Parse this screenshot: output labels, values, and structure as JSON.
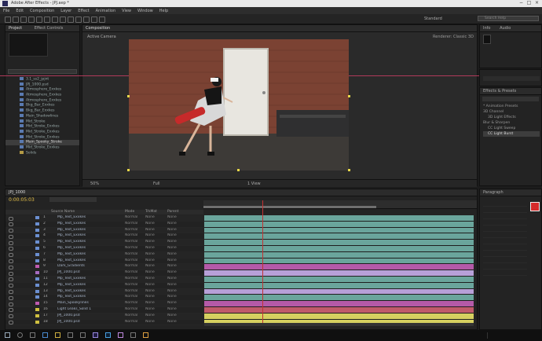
{
  "app": {
    "title": "Adobe After Effects - JPJ.aep *"
  },
  "menu": [
    "File",
    "Edit",
    "Composition",
    "Layer",
    "Effect",
    "Animation",
    "View",
    "Window",
    "Help"
  ],
  "toolbar": {
    "workspace_label": "Standard",
    "search_placeholder": "Search Help"
  },
  "project": {
    "tab": "Project",
    "tab2": "Effect Controls",
    "items": [
      "3.1_ss2_jpjnt",
      "JPJ_1000.psd",
      "Atmosphere_Exxkes",
      "Atmosphere_Exxkes",
      "Atmosphere_Exxkes",
      "Bkg_Bar_Exxkes",
      "Bkg_Bar_Exxkes",
      "Main_Shadowlines",
      "Mid_Stroke",
      "Mid_Stroke_Exxkes",
      "Mid_Stroke_Exxkes",
      "Mid_Stroke_Exxkes",
      "Main_Spooky_Stroke",
      "Mid_Stroke_Exxkes",
      "Solids"
    ],
    "selected_index": 12
  },
  "viewer": {
    "tab": "Composition",
    "camera_label": "Active Camera",
    "renderer_label": "Renderer: Classic 3D",
    "zoom": "50%",
    "res": "Full",
    "view": "1 View"
  },
  "timeline": {
    "tab": "JPJ_1000",
    "timecode": "0:00:05:03",
    "col_headers": {
      "name": "Source Name",
      "mode": "Mode",
      "trk": "TrkMat",
      "parent": "Parent"
    },
    "layers": [
      {
        "num": "1",
        "name": "Mp_Text_Exxkes",
        "color": "#6b8fd0"
      },
      {
        "num": "2",
        "name": "Mp_Text_Exxkes",
        "color": "#6b8fd0"
      },
      {
        "num": "3",
        "name": "Mp_Text_Exxkes",
        "color": "#6b8fd0"
      },
      {
        "num": "4",
        "name": "Mp_Text_Exxkes",
        "color": "#6b8fd0"
      },
      {
        "num": "5",
        "name": "Mp_Text_Exxkes",
        "color": "#6b8fd0"
      },
      {
        "num": "6",
        "name": "Mp_Text_Exxkes",
        "color": "#6b8fd0"
      },
      {
        "num": "7",
        "name": "Mp_Text_Exxkes",
        "color": "#6b8fd0"
      },
      {
        "num": "8",
        "name": "Mp_Text_Exxkes",
        "color": "#6b8fd0"
      },
      {
        "num": "9",
        "name": "Dark_Gradients",
        "color": "#c05ab0"
      },
      {
        "num": "10",
        "name": "JPJ_1000.psd",
        "color": "#a66bc0"
      },
      {
        "num": "11",
        "name": "Mp_Text_Exxkes",
        "color": "#6b8fd0"
      },
      {
        "num": "12",
        "name": "Mp_Text_Exxkes",
        "color": "#6b8fd0"
      },
      {
        "num": "13",
        "name": "Mp_Text_Exxkes",
        "color": "#6b8fd0"
      },
      {
        "num": "14",
        "name": "Mp_Text_Exxkes",
        "color": "#6b8fd0"
      },
      {
        "num": "15",
        "name": "Main_Spookylines",
        "color": "#c05ab0"
      },
      {
        "num": "16",
        "name": "Light Leaks_Solid 1",
        "color": "#d0c040"
      },
      {
        "num": "17",
        "name": "JPJ_1000.psd",
        "color": "#d0c040"
      },
      {
        "num": "18",
        "name": "JPJ_1000.psd",
        "color": "#d0c040"
      }
    ],
    "bar_colors": [
      "#6aa59c",
      "#6aa59c",
      "#6aa59c",
      "#6aa59c",
      "#6aa59c",
      "#6aa59c",
      "#6aa59c",
      "#6aa59c",
      "#b45aa8",
      "#b7a0d8",
      "#6aa59c",
      "#6aa59c",
      "#b7a0d8",
      "#6aa59c",
      "#b45aa8",
      "#c05a6a",
      "#d6d060",
      "#d6d060"
    ],
    "mode_label": "Normal",
    "trk_label": "None",
    "parent_label": "None"
  },
  "right": {
    "info_tab": "Info",
    "audio_tab": "Audio",
    "effects_tab": "Effects & Presets",
    "effects_items": [
      "* Animation Presets",
      "3D Channel",
      "3D Light Effects",
      "Blur & Sharpen",
      "CC Light Sweep",
      "CC Light Burst"
    ],
    "paragraph_tab": "Paragraph"
  }
}
